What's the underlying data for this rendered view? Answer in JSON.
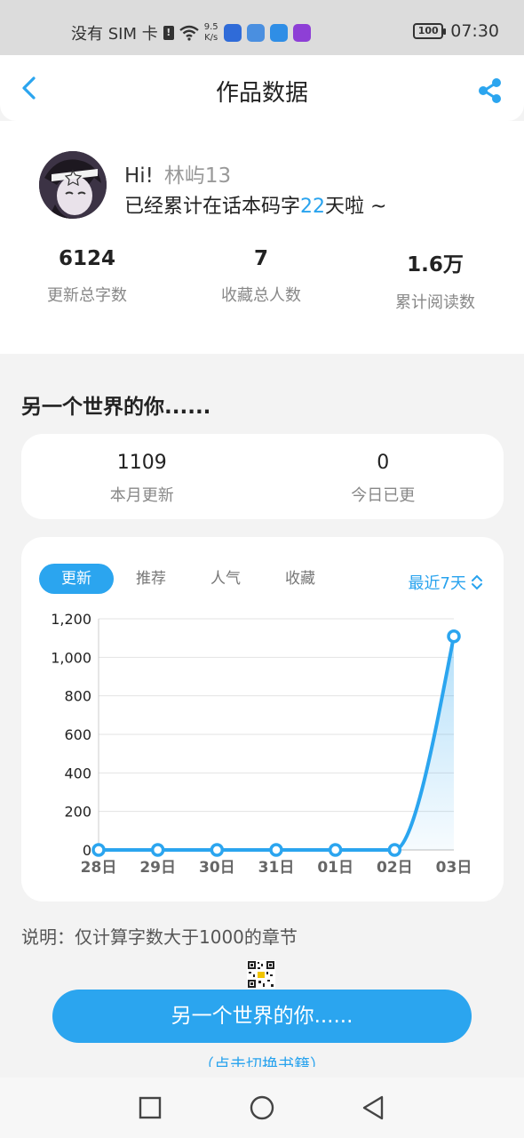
{
  "status_bar": {
    "carrier": "没有 SIM 卡",
    "net_speed_value": "9.5",
    "net_speed_unit": "K/s",
    "battery": "100",
    "time": "07:30"
  },
  "nav": {
    "title": "作品数据"
  },
  "profile": {
    "hi": "Hi!",
    "username": "林屿13",
    "days_prefix": "已经累计在话本码字",
    "days": "22",
    "days_suffix": "天啦 ~",
    "stats": [
      {
        "value": "6124",
        "label": "更新总字数"
      },
      {
        "value": "7",
        "label": "收藏总人数"
      },
      {
        "value": "1.6万",
        "label": "累计阅读数"
      }
    ]
  },
  "book": {
    "title": "另一个世界的你......"
  },
  "summary": [
    {
      "value": "1109",
      "label": "本月更新"
    },
    {
      "value": "0",
      "label": "今日已更"
    }
  ],
  "tabs": [
    {
      "label": "更新",
      "active": true
    },
    {
      "label": "推荐",
      "active": false
    },
    {
      "label": "人气",
      "active": false
    },
    {
      "label": "收藏",
      "active": false
    }
  ],
  "range": {
    "label": "最近7天"
  },
  "chart_data": {
    "type": "area",
    "categories": [
      "28日",
      "29日",
      "30日",
      "31日",
      "01日",
      "02日",
      "03日"
    ],
    "values": [
      0,
      0,
      0,
      0,
      0,
      0,
      1109
    ],
    "yticks": [
      "0",
      "200",
      "400",
      "600",
      "800",
      "1,000",
      "1,200"
    ],
    "ylim": [
      0,
      1200
    ],
    "grid": true,
    "color": "#2ba5ef"
  },
  "note": "说明：仅计算字数大于1000的章节",
  "switch": {
    "label": "另一个世界的你......",
    "hint": "（点击切换书籍）"
  },
  "colors": {
    "accent": "#2ba5ef"
  }
}
